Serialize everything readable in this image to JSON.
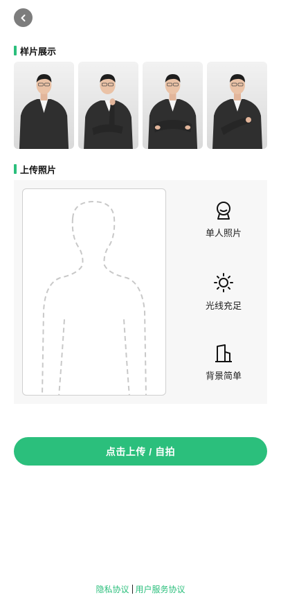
{
  "header": {
    "back_icon": "chevron-left-icon"
  },
  "samples_section": {
    "title": "样片展示",
    "samples": [
      {
        "pose": "hands-down"
      },
      {
        "pose": "hand-on-chin"
      },
      {
        "pose": "arms-crossed"
      },
      {
        "pose": "adjusting-cuff"
      }
    ]
  },
  "upload_section": {
    "title": "上传照片",
    "tips": [
      {
        "label": "单人照片",
        "icon": "person-head-icon"
      },
      {
        "label": "光线充足",
        "icon": "sun-icon"
      },
      {
        "label": "背景简单",
        "icon": "building-icon"
      }
    ]
  },
  "cta": {
    "label": "点击上传 / 自拍"
  },
  "footer": {
    "privacy": "隐私协议",
    "service": "用户服务协议"
  },
  "colors": {
    "accent": "#2bbf7c",
    "panel_bg": "#f7f7f7"
  }
}
